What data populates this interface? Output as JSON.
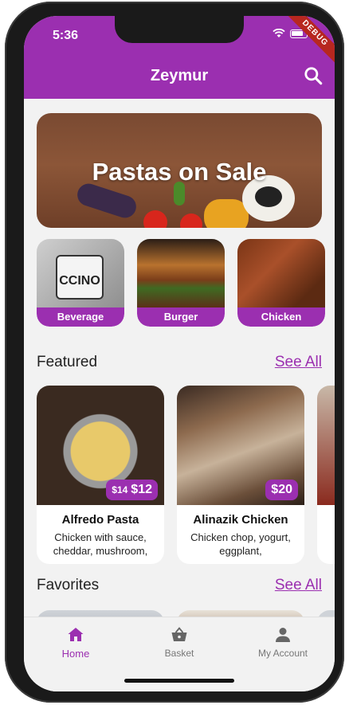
{
  "status_bar": {
    "time": "5:36",
    "debug_label": "DEBUG"
  },
  "app_bar": {
    "title": "Zeymur",
    "search_icon": "search-icon"
  },
  "banner": {
    "title": "Pastas on Sale"
  },
  "categories": [
    {
      "label": "Beverage",
      "mug_text": "CCINO"
    },
    {
      "label": "Burger"
    },
    {
      "label": "Chicken"
    }
  ],
  "featured": {
    "title": "Featured",
    "see_all": "See All",
    "items": [
      {
        "name": "Alfredo Pasta",
        "description": "Chicken with sauce, cheddar, mushroom,",
        "old_price": "$14",
        "price": "$12"
      },
      {
        "name": "Alinazik Chicken",
        "description": "Chicken chop, yogurt, eggplant,",
        "price": "$20"
      }
    ]
  },
  "favorites": {
    "title": "Favorites",
    "see_all": "See All"
  },
  "bottom_nav": {
    "items": [
      {
        "label": "Home",
        "icon": "home-icon",
        "active": true
      },
      {
        "label": "Basket",
        "icon": "basket-icon",
        "active": false
      },
      {
        "label": "My Account",
        "icon": "person-icon",
        "active": false
      }
    ]
  },
  "colors": {
    "primary": "#9b2fb0",
    "background": "#f2f2f2",
    "debug": "#b7271f"
  }
}
